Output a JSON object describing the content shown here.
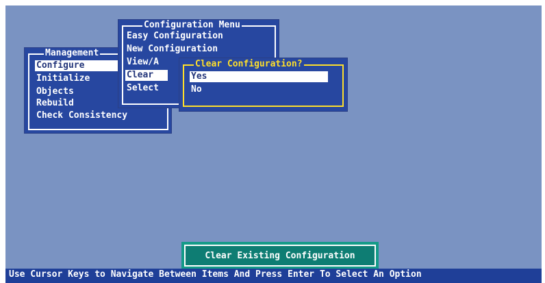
{
  "management_menu": {
    "title": "Management",
    "items": [
      {
        "label": "Configure"
      },
      {
        "label": "Initialize"
      },
      {
        "label": "Objects"
      },
      {
        "label": "Rebuild"
      },
      {
        "label": "Check Consistency"
      }
    ]
  },
  "configuration_menu": {
    "title": "Configuration Menu",
    "items": [
      {
        "label": "Easy Configuration"
      },
      {
        "label": "New Configuration"
      },
      {
        "label": "View/A"
      },
      {
        "label": "Clear"
      },
      {
        "label": "Select"
      }
    ]
  },
  "clear_dialog": {
    "title": "Clear Configuration?",
    "yes": "Yes",
    "no": "No"
  },
  "status": {
    "label": "Clear Existing Configuration"
  },
  "help_bar": {
    "text": "Use Cursor Keys to Navigate Between Items And Press Enter To Select An Option"
  },
  "colors": {
    "screen_background": "#7a93c2",
    "menu_background": "#2747a0",
    "dialog_border": "#ffdf2a",
    "status_background": "#0e7d73"
  }
}
